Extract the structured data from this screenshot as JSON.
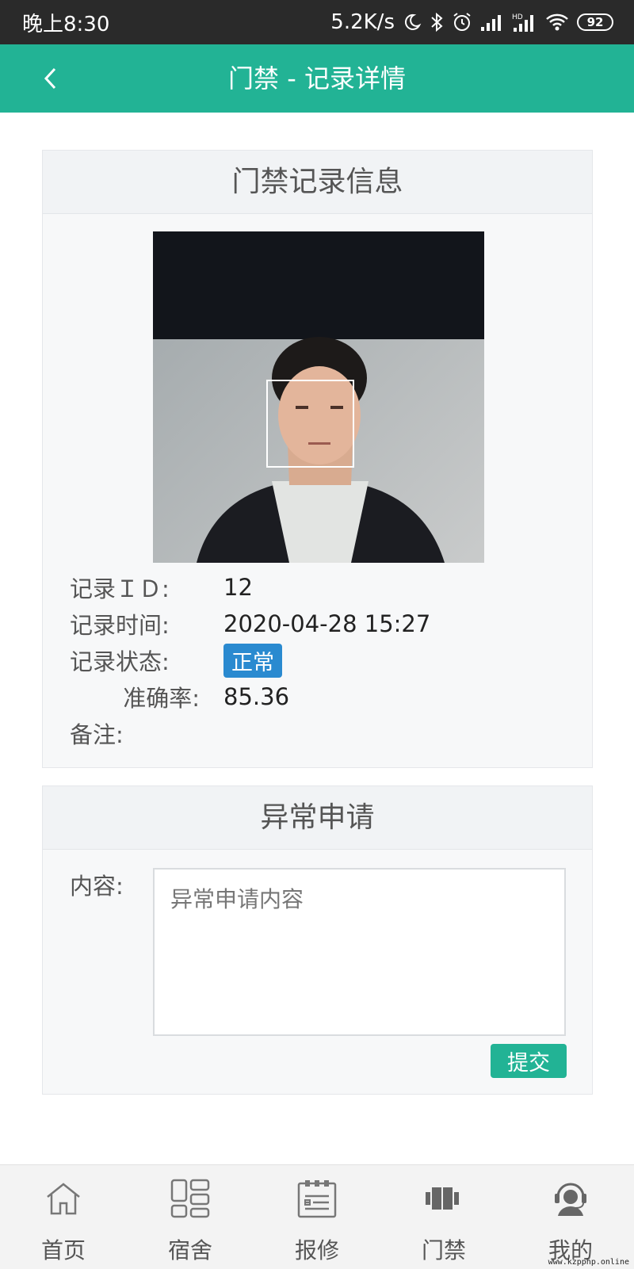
{
  "status_bar": {
    "time": "晚上8:30",
    "net_speed": "5.2K/s",
    "battery": "92"
  },
  "header": {
    "title": "门禁 - 记录详情"
  },
  "record_card": {
    "title": "门禁记录信息",
    "photo": "face-capture-photo",
    "fields": [
      {
        "label": "记录ＩＤ:",
        "value": "12"
      },
      {
        "label": "记录时间:",
        "value": "2020-04-28 15:27"
      },
      {
        "label": "记录状态:",
        "value": "正常"
      },
      {
        "label": "准确率:",
        "value": "85.36"
      },
      {
        "label": "备注:",
        "value": ""
      }
    ],
    "status_color": "#2a8ad0"
  },
  "appeal_card": {
    "title": "异常申请",
    "content_label": "内容:",
    "content_placeholder": "异常申请内容",
    "submit_label": "提交"
  },
  "tabbar": {
    "items": [
      {
        "label": "首页",
        "icon": "home-icon"
      },
      {
        "label": "宿舍",
        "icon": "dormitory-icon"
      },
      {
        "label": "报修",
        "icon": "repair-icon"
      },
      {
        "label": "门禁",
        "icon": "door-access-icon"
      },
      {
        "label": "我的",
        "icon": "profile-icon"
      }
    ]
  },
  "watermark": "www.kzpphp.online",
  "colors": {
    "accent": "#22b395",
    "status_bar": "#2a2a2a"
  }
}
